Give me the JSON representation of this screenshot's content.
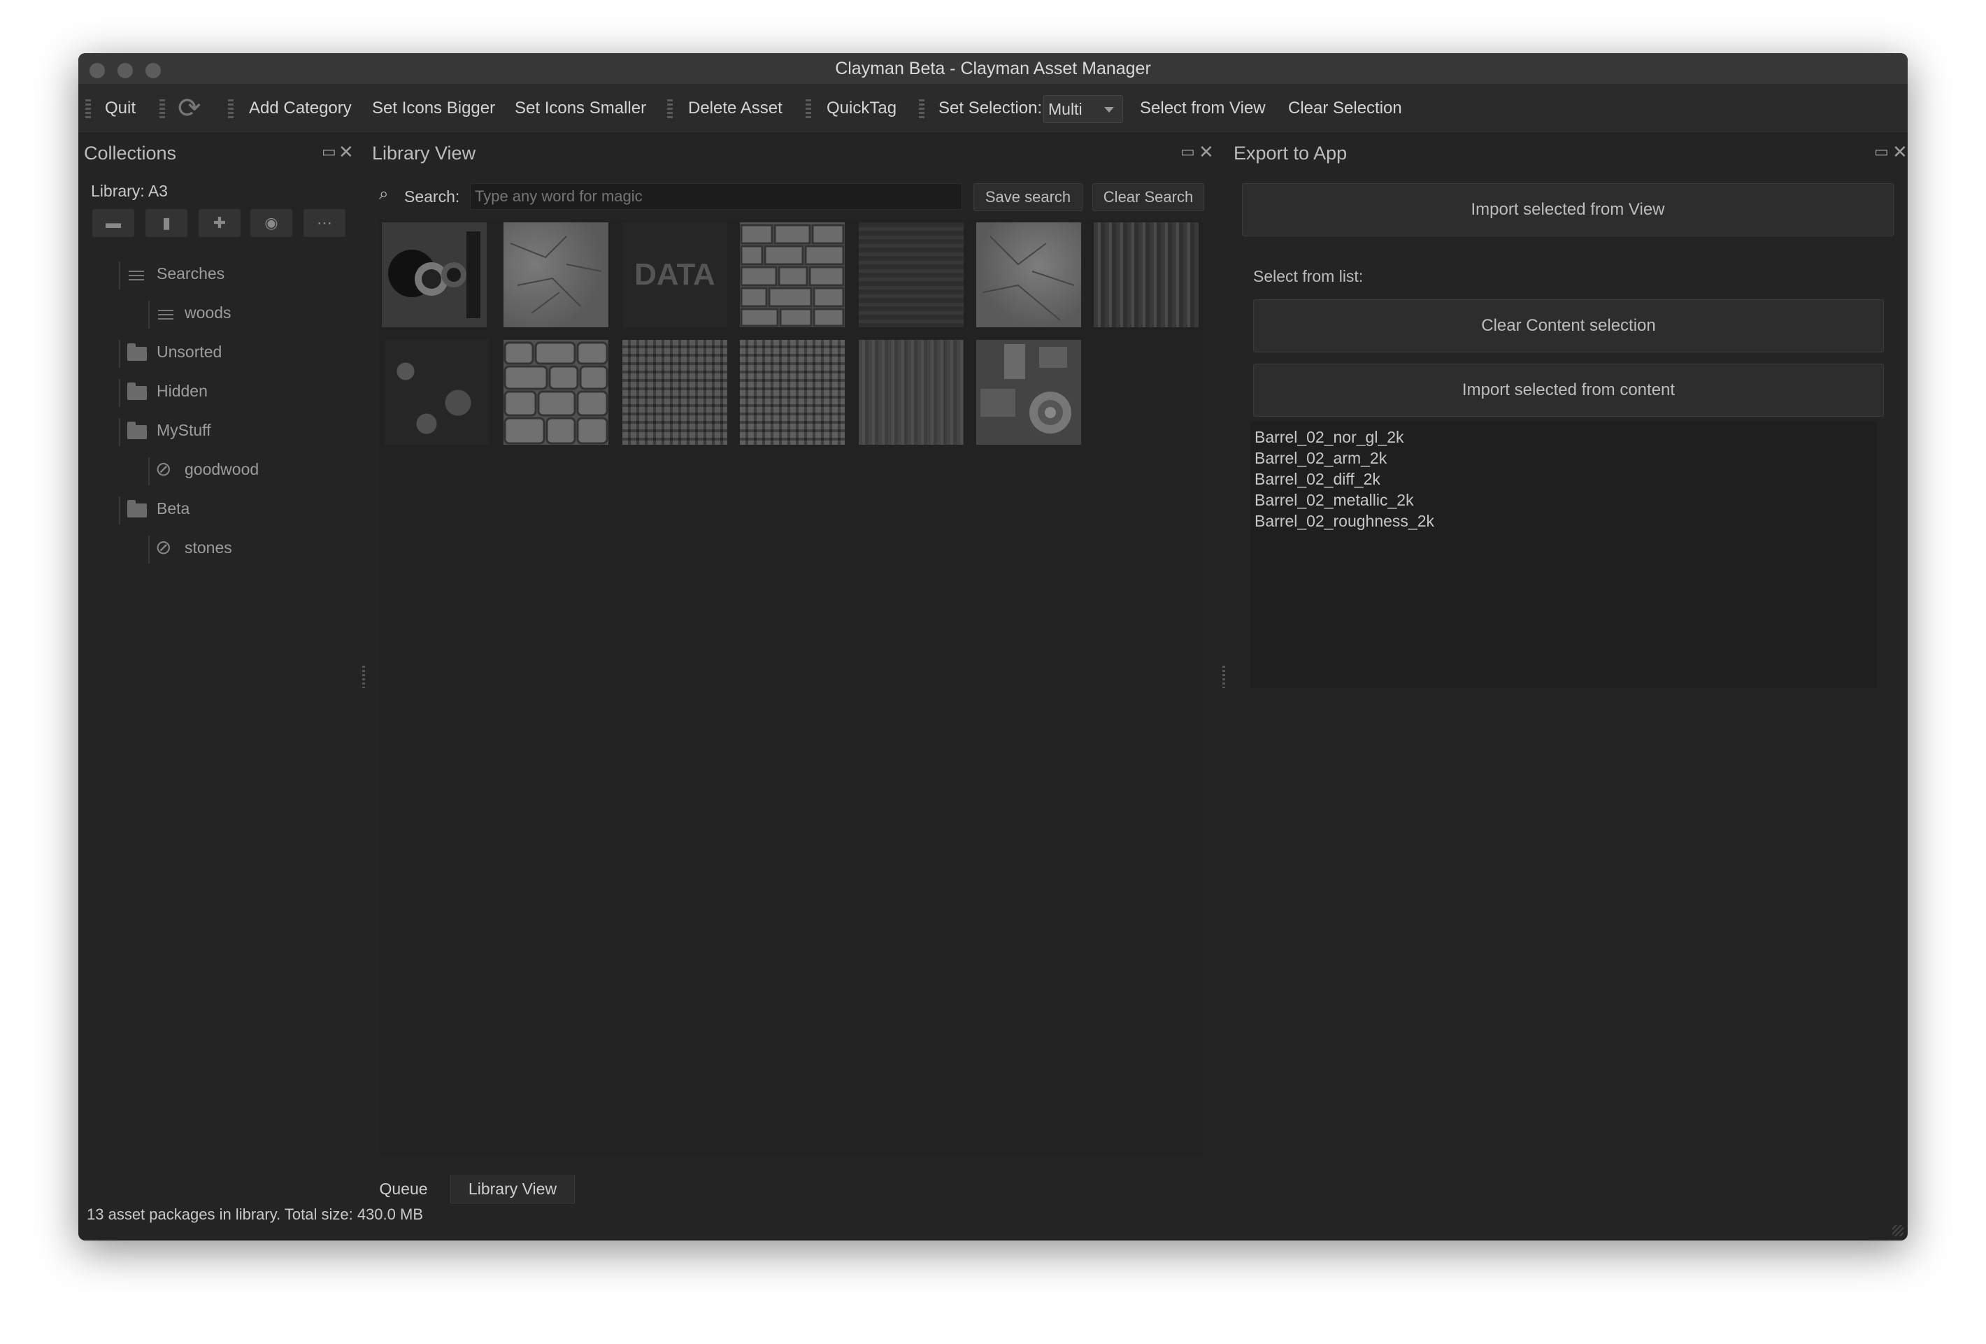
{
  "window": {
    "title": "Clayman Beta - Clayman Asset Manager"
  },
  "toolbar": {
    "quit": "Quit",
    "add_category": "Add Category",
    "set_icons_bigger": "Set Icons Bigger",
    "set_icons_smaller": "Set Icons Smaller",
    "delete_asset": "Delete Asset",
    "quicktag": "QuickTag",
    "set_selection_label": "Set Selection:",
    "selection_mode": "Multi",
    "select_from_view": "Select from View",
    "clear_selection": "Clear Selection"
  },
  "collections": {
    "title": "Collections",
    "library": "Library: A3",
    "tree": {
      "searches": "Searches",
      "woods": "woods",
      "unsorted": "Unsorted",
      "hidden": "Hidden",
      "mystuff": "MyStuff",
      "goodwood": "goodwood",
      "beta": "Beta",
      "stones": "stones"
    }
  },
  "library_view": {
    "title": "Library View",
    "search_label": "Search:",
    "search_placeholder": "Type any word for magic",
    "save_search": "Save search",
    "clear_search": "Clear Search",
    "data_label": "DATA",
    "tabs": {
      "queue": "Queue",
      "library_view": "Library View"
    }
  },
  "export": {
    "title": "Export to App",
    "import_from_view": "Import selected from View",
    "select_from_list": "Select from list:",
    "clear_content": "Clear Content selection",
    "import_from_content": "Import selected from content",
    "items": [
      "Barrel_02_nor_gl_2k",
      "Barrel_02_arm_2k",
      "Barrel_02_diff_2k",
      "Barrel_02_metallic_2k",
      "Barrel_02_roughness_2k"
    ]
  },
  "status": "13 asset packages in library. Total size: 430.0 MB"
}
